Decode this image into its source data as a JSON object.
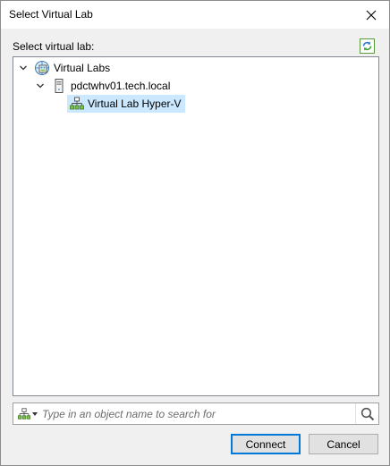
{
  "window": {
    "title": "Select Virtual Lab"
  },
  "section": {
    "label": "Select virtual lab:"
  },
  "tree": {
    "root": {
      "label": "Virtual Labs",
      "expanded": true
    },
    "host": {
      "label": "pdctwhv01.tech.local",
      "expanded": true
    },
    "lab": {
      "label": "Virtual Lab Hyper-V",
      "selected": true
    }
  },
  "search": {
    "placeholder": "Type in an object name to search for",
    "value": ""
  },
  "buttons": {
    "connect": "Connect",
    "cancel": "Cancel"
  },
  "colors": {
    "selection": "#cce8ff",
    "accent": "#0078d7",
    "dialog_bg": "#f0f0f0"
  }
}
